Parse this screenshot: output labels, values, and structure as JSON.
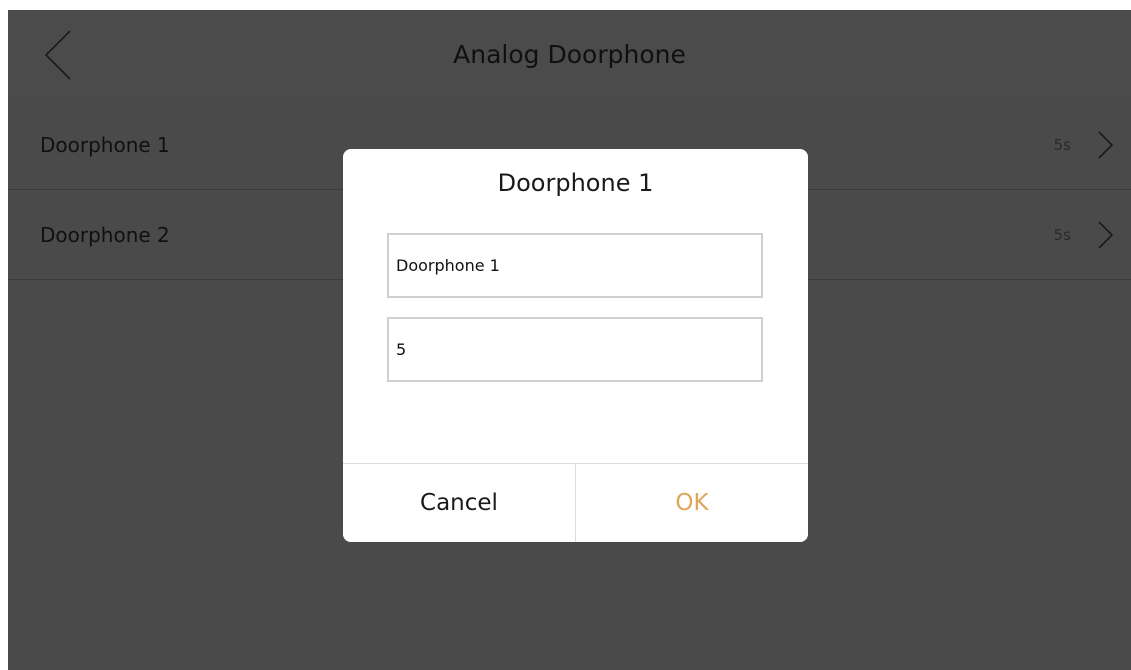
{
  "header": {
    "title": "Analog Doorphone",
    "back_icon": "chevron-left-icon"
  },
  "list": {
    "items": [
      {
        "label": "Doorphone 1",
        "value": "5s",
        "icon": "chevron-right-icon"
      },
      {
        "label": "Doorphone 2",
        "value": "5s",
        "icon": "chevron-right-icon"
      }
    ]
  },
  "dialog": {
    "title": "Doorphone 1",
    "name_value": "Doorphone 1",
    "time_value": "5",
    "cancel_label": "Cancel",
    "ok_label": "OK"
  },
  "colors": {
    "background": "#4a4a4a",
    "dialog_background": "#ffffff",
    "accent": "#e0a55a",
    "text": "#101010"
  }
}
